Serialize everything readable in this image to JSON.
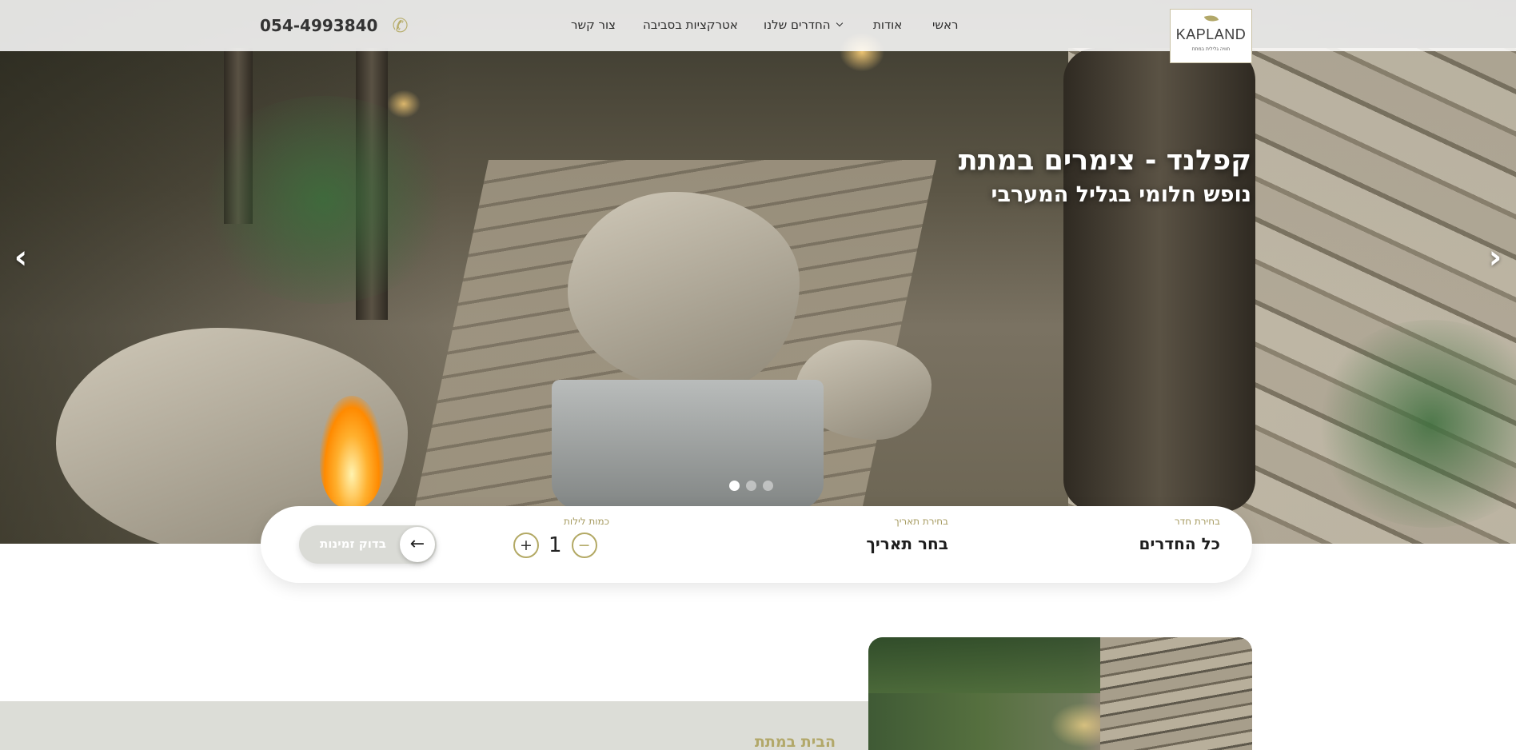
{
  "header": {
    "logo": {
      "name": "KAPLAND",
      "tagline": "חוויה גלילית במתת"
    },
    "nav": [
      {
        "label": "ראשי"
      },
      {
        "label": "אודות"
      },
      {
        "label": "החדרים שלנו",
        "has_dropdown": true
      },
      {
        "label": "אטרקציות בסביבה"
      },
      {
        "label": "צור קשר"
      }
    ],
    "phone": "054-4993840",
    "phone_icon": "phone-icon"
  },
  "hero": {
    "title": "קפלנד - צימרים במתת",
    "subtitle": "נופש חלומי בגליל המערבי",
    "prev_arrow": "‹",
    "next_arrow": "›",
    "slides_count": 3,
    "active_slide": 1
  },
  "booking": {
    "room_label": "בחירת חדר",
    "room_value": "כל החדרים",
    "date_label": "בחירת תאריך",
    "date_value": "בחר תאריך",
    "nights_label": "כמות לילות",
    "nights_value": "1",
    "minus": "−",
    "plus": "+",
    "check_button": "בדוק זמינות",
    "check_arrow": "←"
  },
  "section": {
    "title": "הבית במתת"
  },
  "colors": {
    "accent": "#b2a86a",
    "gray_band": "#dcddd7"
  }
}
